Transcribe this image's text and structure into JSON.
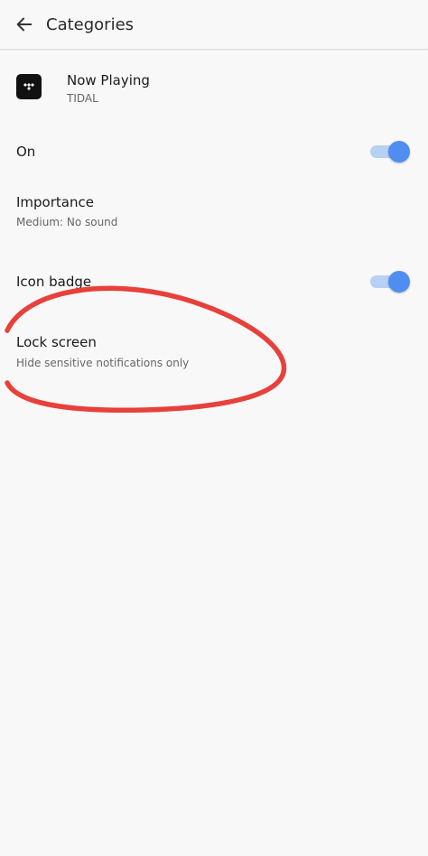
{
  "header": {
    "title": "Categories",
    "back_icon": "arrow-left-icon"
  },
  "app": {
    "name": "Now Playing",
    "publisher": "TIDAL",
    "icon": "tidal-logo-icon"
  },
  "settings": {
    "on": {
      "label": "On",
      "enabled": true
    },
    "importance": {
      "label": "Importance",
      "value": "Medium: No sound"
    },
    "icon_badge": {
      "label": "Icon badge",
      "enabled": true
    },
    "lock_screen": {
      "label": "Lock screen",
      "value": "Hide sensitive notifications only"
    }
  },
  "colors": {
    "toggle_on_thumb": "#4f8ef0",
    "toggle_on_track": "#b9d0f5",
    "annotation": "#e8403a",
    "background": "#f8f8f8"
  }
}
